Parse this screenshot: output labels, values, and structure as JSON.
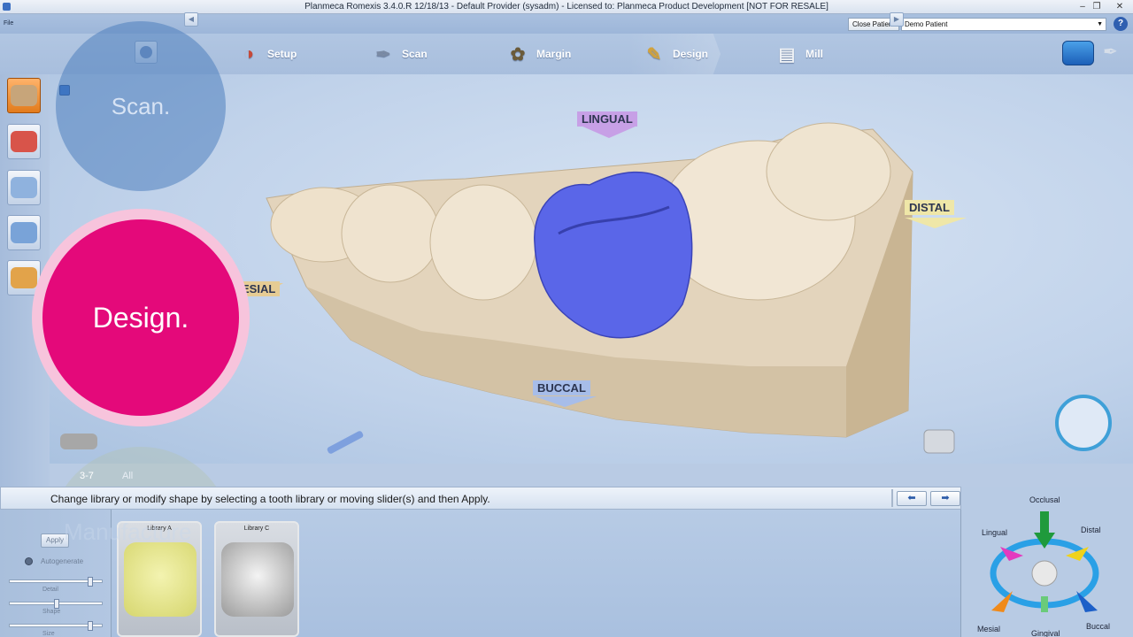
{
  "window": {
    "title": "Planmeca Romexis 3.4.0.R  12/18/13 - Default Provider (sysadm) - Licensed to: Planmeca Product Development [NOT FOR RESALE]",
    "menu_file": "File",
    "close_patient": "Close Patient",
    "patient": "Demo Patient"
  },
  "workflow": {
    "steps": [
      {
        "label": "Setup",
        "icon": "setup-icon"
      },
      {
        "label": "Scan",
        "icon": "scan-wand-icon"
      },
      {
        "label": "Margin",
        "icon": "margin-ring-icon"
      },
      {
        "label": "Design",
        "icon": "pen-icon",
        "active": true
      },
      {
        "label": "Mill",
        "icon": "mill-icon"
      }
    ]
  },
  "viewport": {
    "labels": {
      "lingual": "LINGUAL",
      "distal": "DISTAL",
      "mesial": "ESIAL",
      "buccal": "BUCCAL"
    }
  },
  "overlays": {
    "scan": "Scan.",
    "design": "Design.",
    "manufacture": "Manufacture"
  },
  "tabs": {
    "tooth": "3-7",
    "all": "All"
  },
  "hint": "Change library or modify shape by selecting a tooth library or moving slider(s) and then Apply.",
  "controls": {
    "apply": "Apply",
    "autogenerate": "Autogenerate",
    "slider_labels": [
      "Detail",
      "Shape",
      "Size"
    ]
  },
  "libraries": [
    {
      "name": "Library A",
      "color": "#e3e38a"
    },
    {
      "name": "Library C",
      "color": "#c9c9c9"
    }
  ],
  "orientation": {
    "occlusal": "Occlusal",
    "lingual": "Lingual",
    "distal": "Distal",
    "mesial": "Mesial",
    "gingival": "Gingival",
    "buccal": "Buccal"
  },
  "colors": {
    "crown": "#5a66e8",
    "model": "#e9dcc6",
    "design_overlay": "#e4097a",
    "active_tool": "#f08a2a"
  }
}
